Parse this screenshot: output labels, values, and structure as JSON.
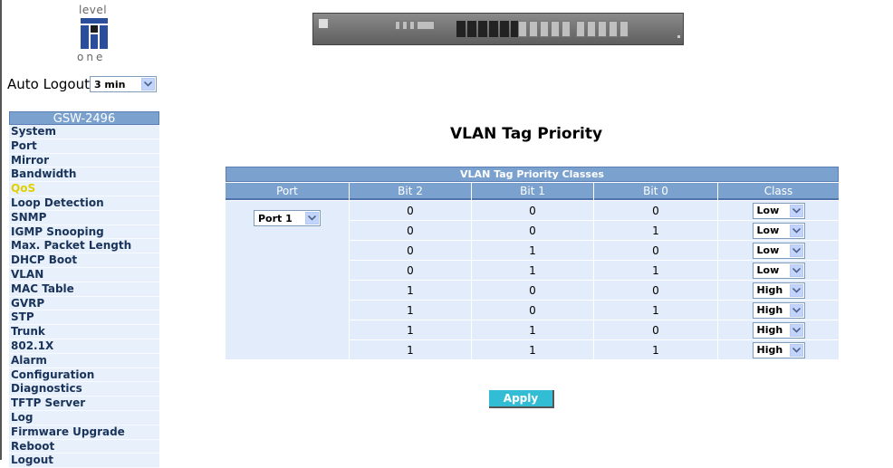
{
  "brand": {
    "logo_top": "level",
    "logo_bottom": "one",
    "logo_colors": {
      "blue": "#2a4d9c",
      "dark": "#1b1b1b"
    }
  },
  "auto_logout": {
    "label": "Auto Logout",
    "value": "3 min"
  },
  "menu": {
    "header": "GSW-2496",
    "active_color": "#e0d000",
    "items": [
      {
        "label": "System"
      },
      {
        "label": "Port"
      },
      {
        "label": "Mirror"
      },
      {
        "label": "Bandwidth"
      },
      {
        "label": "QoS",
        "active": true
      },
      {
        "label": "Loop Detection"
      },
      {
        "label": "SNMP"
      },
      {
        "label": "IGMP Snooping"
      },
      {
        "label": "Max. Packet Length"
      },
      {
        "label": "DHCP Boot"
      },
      {
        "label": "VLAN"
      },
      {
        "label": "MAC Table"
      },
      {
        "label": "GVRP"
      },
      {
        "label": "STP"
      },
      {
        "label": "Trunk"
      },
      {
        "label": "802.1X"
      },
      {
        "label": "Alarm"
      },
      {
        "label": "Configuration"
      },
      {
        "label": "Diagnostics"
      },
      {
        "label": "TFTP Server"
      },
      {
        "label": "Log"
      },
      {
        "label": "Firmware Upgrade"
      },
      {
        "label": "Reboot"
      },
      {
        "label": "Logout"
      }
    ]
  },
  "page": {
    "title": "VLAN Tag Priority"
  },
  "table": {
    "caption": "VLAN Tag Priority Classes",
    "columns": [
      "Port",
      "Bit 2",
      "Bit 1",
      "Bit 0",
      "Class"
    ],
    "port_value": "Port 1",
    "rows": [
      {
        "bit2": "0",
        "bit1": "0",
        "bit0": "0",
        "class": "Low"
      },
      {
        "bit2": "0",
        "bit1": "0",
        "bit0": "1",
        "class": "Low"
      },
      {
        "bit2": "0",
        "bit1": "1",
        "bit0": "0",
        "class": "Low"
      },
      {
        "bit2": "0",
        "bit1": "1",
        "bit0": "1",
        "class": "Low"
      },
      {
        "bit2": "1",
        "bit1": "0",
        "bit0": "0",
        "class": "High"
      },
      {
        "bit2": "1",
        "bit1": "0",
        "bit0": "1",
        "class": "High"
      },
      {
        "bit2": "1",
        "bit1": "1",
        "bit0": "0",
        "class": "High"
      },
      {
        "bit2": "1",
        "bit1": "1",
        "bit0": "1",
        "class": "High"
      }
    ]
  },
  "apply_label": "Apply",
  "colors": {
    "header_blue": "#7ba1ce",
    "cell_bg": "#e2ecfa",
    "apply_bg": "#33bdd5"
  }
}
